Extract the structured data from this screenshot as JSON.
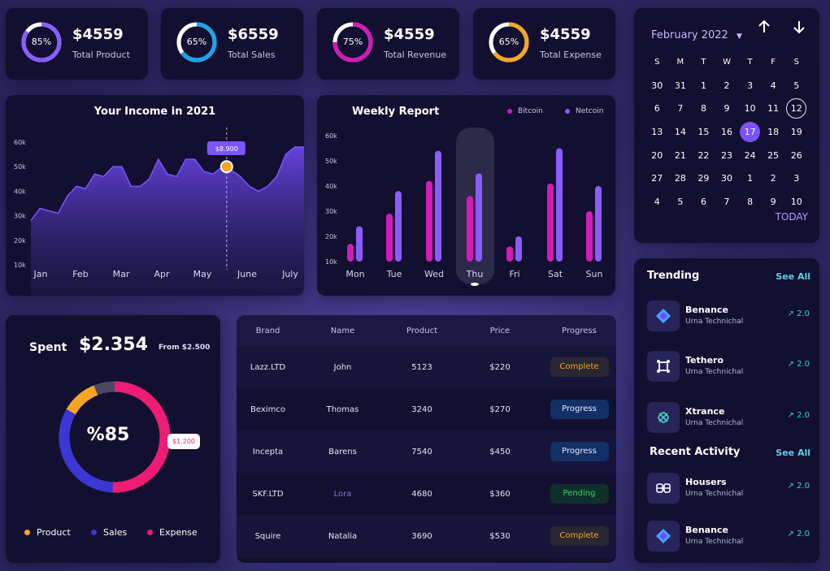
{
  "stats": [
    {
      "pct": "85%",
      "value": "$4559",
      "label": "Total Product",
      "percent": 85,
      "colors": [
        "#8a5cff",
        "#a98bff"
      ]
    },
    {
      "pct": "65%",
      "value": "$6559",
      "label": "Total Sales",
      "percent": 65,
      "colors": [
        "#1aa3e8",
        "#1aa3e8"
      ]
    },
    {
      "pct": "75%",
      "value": "$4559",
      "label": "Total Revenue",
      "percent": 75,
      "colors": [
        "#d21bb8",
        "#d21bb8"
      ]
    },
    {
      "pct": "65%",
      "value": "$4559",
      "label": "Total Expense",
      "percent": 65,
      "colors": [
        "#f6a623",
        "#f6a623"
      ]
    }
  ],
  "income": {
    "title": "Your Income in 2021",
    "tooltip": "$8.900"
  },
  "weekly": {
    "title": "Weekly Report",
    "legend": [
      "Bitcoin",
      "Netcoin"
    ]
  },
  "calendar": {
    "month": "February 2022",
    "weekdays": [
      "S",
      "M",
      "T",
      "W",
      "T",
      "F",
      "S"
    ],
    "weeks": [
      [
        "30",
        "31",
        "1",
        "2",
        "3",
        "4",
        "5"
      ],
      [
        "6",
        "7",
        "8",
        "9",
        "10",
        "11",
        "12"
      ],
      [
        "13",
        "14",
        "15",
        "16",
        "17",
        "18",
        "19"
      ],
      [
        "20",
        "21",
        "22",
        "23",
        "24",
        "25",
        "26"
      ],
      [
        "27",
        "28",
        "29",
        "30",
        "1",
        "2",
        "3"
      ],
      [
        "4",
        "5",
        "6",
        "7",
        "8",
        "9",
        "10"
      ]
    ],
    "selected": "17",
    "today_label": "TODAY"
  },
  "trending": {
    "title": "Trending",
    "see_all": "See All",
    "items": [
      {
        "name": "Benance",
        "sub": "Urna Technichal",
        "trend": "2.0",
        "icon": "diamond-icon"
      },
      {
        "name": "Tethero",
        "sub": "Urna Technichal",
        "trend": "2.0",
        "icon": "tether-icon"
      },
      {
        "name": "Xtrance",
        "sub": "Urna Technichal",
        "trend": "2.0",
        "icon": "xtrance-icon"
      }
    ]
  },
  "recent": {
    "title": "Recent Activity",
    "see_all": "See All",
    "items": [
      {
        "name": "Housers",
        "sub": "Urna Technichal",
        "trend": "2.0",
        "icon": "housers-icon"
      },
      {
        "name": "Benance",
        "sub": "Urna Technichal",
        "trend": "2.0",
        "icon": "diamond-icon"
      }
    ]
  },
  "spent": {
    "label": "Spent",
    "amount": "$2.354",
    "from": "From $2.500",
    "center": "%85",
    "tooltip": "$1.200",
    "legend": [
      "Product",
      "Sales",
      "Expense"
    ],
    "colors": [
      "#f6a623",
      "#3b37d4",
      "#ee1c74"
    ]
  },
  "table": {
    "headers": [
      "Brand",
      "Name",
      "Product",
      "Price",
      "Progress"
    ],
    "rows": [
      [
        "Lazz.LTD",
        "John",
        "5123",
        "$220",
        "Complete"
      ],
      [
        "Beximco",
        "Thomas",
        "3240",
        "$270",
        "Progress"
      ],
      [
        "Incepta",
        "Barens",
        "7540",
        "$450",
        "Progress"
      ],
      [
        "SKF.LTD",
        "Lora",
        "4680",
        "$360",
        "Pending"
      ],
      [
        "Squire",
        "Natalia",
        "3690",
        "$530",
        "Complete"
      ]
    ]
  },
  "chart_data": [
    {
      "type": "area",
      "title": "Your Income in 2021",
      "categories": [
        "Jan",
        "Feb",
        "Mar",
        "Apr",
        "May",
        "June",
        "July"
      ],
      "y_ticks": [
        "60k",
        "50k",
        "40k",
        "30k",
        "20k",
        "10k"
      ],
      "ylim": [
        10000,
        60000
      ],
      "x": [
        0,
        0.2,
        0.4,
        0.6,
        0.8,
        1.0,
        1.2,
        1.4,
        1.6,
        1.8,
        2.0,
        2.2,
        2.4,
        2.6,
        2.8,
        3.0,
        3.2,
        3.4,
        3.6,
        3.8,
        4.0,
        4.2,
        4.3,
        4.6,
        4.8,
        5.0,
        5.2,
        5.4,
        5.6,
        5.8,
        6.0
      ],
      "y": [
        28000,
        33000,
        32000,
        31000,
        38000,
        42000,
        41000,
        47000,
        46000,
        50000,
        50000,
        42000,
        42000,
        45000,
        53000,
        47000,
        46000,
        53000,
        53000,
        48000,
        47000,
        50000,
        50000,
        46000,
        42000,
        40000,
        42000,
        46000,
        55000,
        58000,
        58000
      ]
    },
    {
      "type": "bar",
      "title": "Weekly Report",
      "categories": [
        "Mon",
        "Tue",
        "Wed",
        "Thu",
        "Fri",
        "Sat",
        "Sun"
      ],
      "y_ticks": [
        "60k",
        "50k",
        "40k",
        "30k",
        "20k",
        "10k"
      ],
      "ylim": [
        10000,
        60000
      ],
      "series": [
        {
          "name": "Bitcoin",
          "color": "#d21bb8",
          "values": [
            17000,
            29000,
            42000,
            36000,
            16000,
            41000,
            30000
          ]
        },
        {
          "name": "Netcoin",
          "color": "#8a5cff",
          "values": [
            24000,
            38000,
            54000,
            45000,
            20000,
            55000,
            40000
          ]
        }
      ]
    },
    {
      "type": "pie",
      "center": "%85",
      "categories": [
        "Product",
        "Sales",
        "Expense"
      ],
      "values": [
        10,
        40,
        42
      ]
    }
  ]
}
